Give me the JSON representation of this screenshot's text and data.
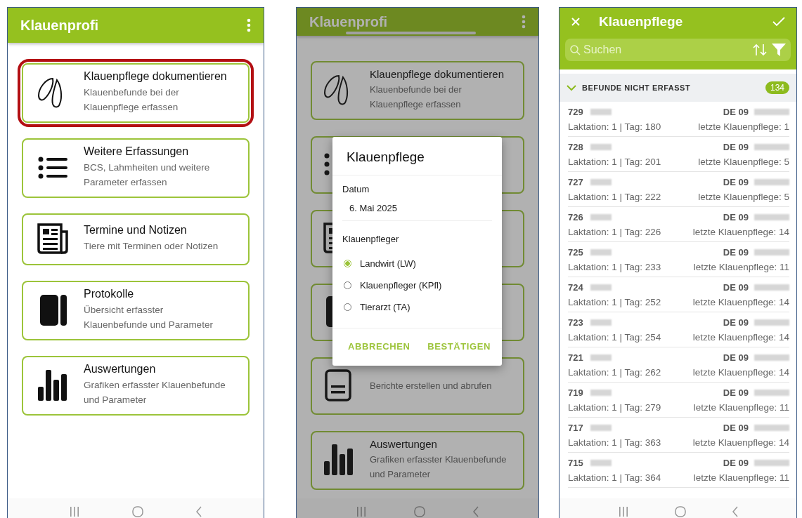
{
  "screens": [
    {
      "kind": "menu",
      "app_bar": {
        "title": "Klauenprofi"
      },
      "cards": [
        {
          "kind": "hoof",
          "title": "Klauenpflege dokumentieren",
          "subtitle_lines": [
            "Klauenbefunde bei der",
            "Klauenpflege erfassen"
          ],
          "highlighted": true
        },
        {
          "kind": "list",
          "title": "Weitere Erfassungen",
          "subtitle_lines": [
            "BCS, Lahmheiten und weitere",
            "Parameter erfassen"
          ],
          "highlighted": false
        },
        {
          "kind": "news",
          "title": "Termine und Notizen",
          "subtitle_lines": [
            "Tiere mit Terminen oder Notizen"
          ],
          "highlighted": false
        },
        {
          "kind": "book",
          "title": "Protokolle",
          "subtitle_lines": [
            "Übersicht erfasster",
            "Klauenbefunde und Parameter"
          ],
          "highlighted": false
        },
        {
          "kind": "chart",
          "title": "Auswertungen",
          "subtitle_lines": [
            "Grafiken erfasster Klauenbefunde",
            "und Parameter"
          ],
          "highlighted": false
        }
      ]
    },
    {
      "kind": "menu",
      "app_bar": {
        "title": "Klauenprofi"
      },
      "cards": [
        {
          "kind": "hoof",
          "title": "Klauenpflege dokumentieren",
          "subtitle_lines": [
            "Klauenbefunde bei der",
            "Klauenpflege erfassen"
          ],
          "highlighted": false
        },
        {
          "kind": "list",
          "highlighted": false
        },
        {
          "kind": "news",
          "highlighted": false
        },
        {
          "kind": "book",
          "highlighted": false
        },
        {
          "kind": "doc",
          "subtitle_lines": [
            "Berichte erstellen und abrufen"
          ],
          "highlighted": false
        },
        {
          "kind": "chart",
          "title": "Auswertungen",
          "subtitle_lines": [
            "Grafiken erfasster Klauenbefunde",
            "und Parameter"
          ],
          "highlighted": false
        }
      ],
      "dialog": {
        "title": "Klauenpflege",
        "date_label": "Datum",
        "date_value": "6. Mai 2025",
        "group_label": "Klauenpfleger",
        "options": [
          {
            "label": "Landwirt (LW)",
            "selected": true
          },
          {
            "label": "Klauenpfleger (KPfl)",
            "selected": false
          },
          {
            "label": "Tierarzt (TA)",
            "selected": false
          }
        ],
        "buttons": [
          "ABBRECHEN",
          "BESTÄTIGEN"
        ]
      }
    },
    {
      "kind": "list",
      "title": "Klauenpflege",
      "search": {
        "placeholder": "Suchen"
      },
      "section": {
        "title": "BEFUNDE NICHT ERFASST",
        "count": "134",
        "expanded": true
      },
      "rows": [
        {
          "number": "729",
          "ear_tag": "DE 09",
          "info": "Laktation: 1 | Tag: 180",
          "last_care": "letzte Klauenpflege: 1"
        },
        {
          "number": "728",
          "ear_tag": "DE 09",
          "info": "Laktation: 1 | Tag: 201",
          "last_care": "letzte Klauenpflege: 5"
        },
        {
          "number": "727",
          "ear_tag": "DE 09",
          "info": "Laktation: 1 | Tag: 222",
          "last_care": "letzte Klauenpflege: 5"
        },
        {
          "number": "726",
          "ear_tag": "DE 09",
          "info": "Laktation: 1 | Tag: 226",
          "last_care": "letzte Klauenpflege: 14"
        },
        {
          "number": "725",
          "ear_tag": "DE 09",
          "info": "Laktation: 1 | Tag: 233",
          "last_care": "letzte Klauenpflege: 11"
        },
        {
          "number": "724",
          "ear_tag": "DE 09",
          "info": "Laktation: 1 | Tag: 252",
          "last_care": "letzte Klauenpflege: 14"
        },
        {
          "number": "723",
          "ear_tag": "DE 09",
          "info": "Laktation: 1 | Tag: 254",
          "last_care": "letzte Klauenpflege: 14"
        },
        {
          "number": "721",
          "ear_tag": "DE 09",
          "info": "Laktation: 1 | Tag: 262",
          "last_care": "letzte Klauenpflege: 14"
        },
        {
          "number": "719",
          "ear_tag": "DE 09",
          "info": "Laktation: 1 | Tag: 279",
          "last_care": "letzte Klauenpflege: 11"
        },
        {
          "number": "717",
          "ear_tag": "DE 09",
          "info": "Laktation: 1 | Tag: 363",
          "last_care": "letzte Klauenpflege: 14"
        },
        {
          "number": "715",
          "ear_tag": "DE 09",
          "info": "Laktation: 1 | Tag: 364",
          "last_care": "letzte Klauenpflege: 11"
        }
      ]
    }
  ]
}
